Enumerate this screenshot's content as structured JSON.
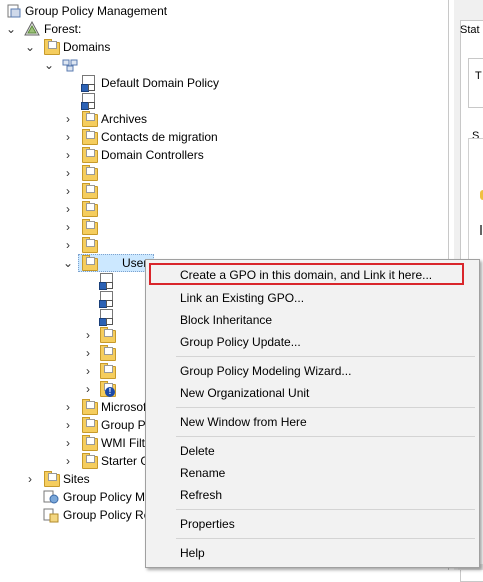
{
  "tree": {
    "root": "Group Policy Management",
    "forest": "Forest:",
    "domains": "Domains",
    "domain_node": "",
    "default_policy": "Default Domain Policy",
    "unnamed_gpo_link": "",
    "ous": [
      "Archives",
      "Contacts de migration",
      "Domain Controllers",
      "",
      "",
      "",
      "",
      ""
    ],
    "users_ou": "Users",
    "users_children_count_gpo": 3,
    "microsoft_node": "Microsof",
    "group_policy_objects": "Group P",
    "wmi_filters": "WMI Filt",
    "starter_gpos": "Starter G",
    "sites": "Sites",
    "modeling": "Group Policy M",
    "results": "Group Policy Re"
  },
  "right_pane": {
    "tab": "Stat",
    "box_text": "T",
    "section": "S"
  },
  "context_menu": {
    "items": [
      "Create a GPO in this domain, and Link it here...",
      "Link an Existing GPO...",
      "Block Inheritance",
      "Group Policy Update...",
      "Group Policy Modeling Wizard...",
      "New Organizational Unit",
      "New Window from Here",
      "Delete",
      "Rename",
      "Refresh",
      "Properties",
      "Help"
    ],
    "highlight_color": "#d9262b"
  },
  "icons": {
    "expanded": "chevron-down-icon",
    "collapsed": "chevron-right-icon",
    "ou": "folder-icon",
    "gpo": "gpo-link-icon"
  }
}
